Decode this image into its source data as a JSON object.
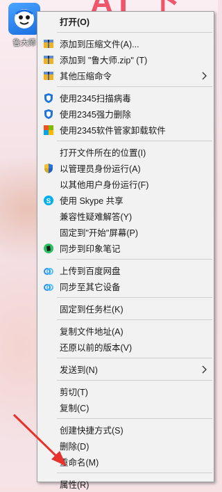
{
  "desktop": {
    "icon_label": "鲁大师",
    "banner_text": "AI 下"
  },
  "menu": {
    "groups": [
      [
        {
          "label": "打开(O)",
          "icon": "none",
          "bold": true
        }
      ],
      [
        {
          "label": "添加到压缩文件(A)...",
          "icon": "archive-icon"
        },
        {
          "label": "添加到 \"鲁大师.zip\" (T)",
          "icon": "archive-icon"
        },
        {
          "label": "其他压缩命令",
          "icon": "archive-icon",
          "submenu": true
        }
      ],
      [
        {
          "label": "使用2345扫描病毒",
          "icon": "shield-icon"
        },
        {
          "label": "使用2345强力删除",
          "icon": "shield-icon"
        },
        {
          "label": "使用2345软件管家卸载软件",
          "icon": "app-grid-icon"
        }
      ],
      [
        {
          "label": "打开文件所在的位置(I)",
          "icon": "none"
        },
        {
          "label": "以管理员身份运行(A)",
          "icon": "uac-shield-icon"
        },
        {
          "label": "以其他用户身份运行(F)",
          "icon": "none"
        },
        {
          "label": "使用 Skype 共享",
          "icon": "skype-icon"
        },
        {
          "label": "兼容性疑难解答(Y)",
          "icon": "none"
        },
        {
          "label": "固定到\"开始\"屏幕(P)",
          "icon": "none"
        },
        {
          "label": "同步到印象笔记",
          "icon": "evernote-icon"
        }
      ],
      [
        {
          "label": "上传到百度网盘",
          "icon": "baidu-cloud-icon"
        },
        {
          "label": "同步至其它设备",
          "icon": "baidu-cloud-icon"
        }
      ],
      [
        {
          "label": "固定到任务栏(K)",
          "icon": "none"
        }
      ],
      [
        {
          "label": "复制文件地址(A)",
          "icon": "none"
        },
        {
          "label": "还原以前的版本(V)",
          "icon": "none"
        }
      ],
      [
        {
          "label": "发送到(N)",
          "icon": "none",
          "submenu": true
        }
      ],
      [
        {
          "label": "剪切(T)",
          "icon": "none"
        },
        {
          "label": "复制(C)",
          "icon": "none"
        }
      ],
      [
        {
          "label": "创建快捷方式(S)",
          "icon": "none"
        },
        {
          "label": "删除(D)",
          "icon": "none"
        },
        {
          "label": "重命名(M)",
          "icon": "none"
        }
      ],
      [
        {
          "label": "属性(R)",
          "icon": "none"
        }
      ]
    ]
  },
  "colors": {
    "menu_bg": "#f2f2f2",
    "separator": "#cfcfcf",
    "arrow_annotation": "#e8312a",
    "banner": "#f0566a"
  }
}
